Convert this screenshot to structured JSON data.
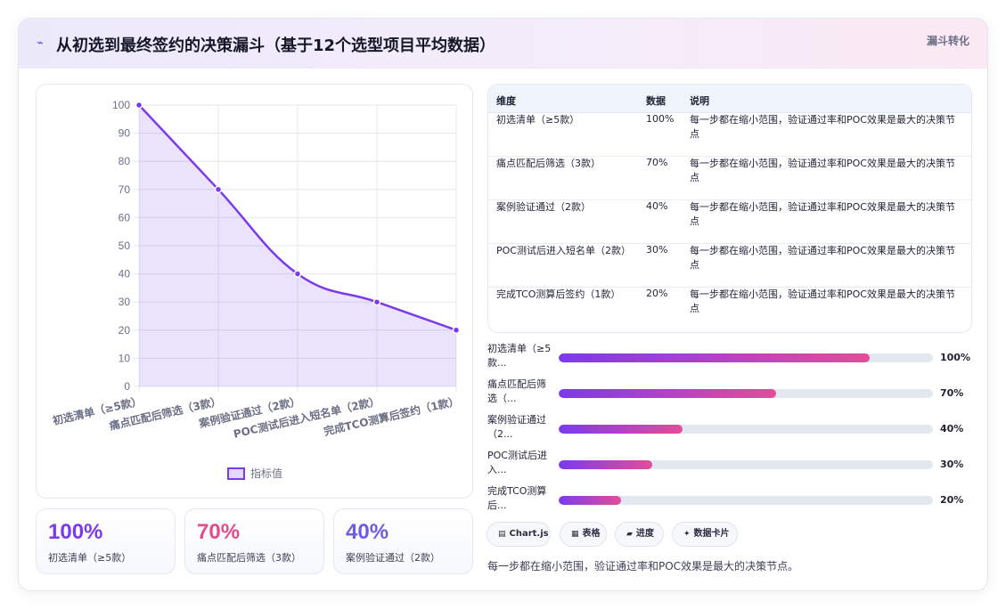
{
  "header": {
    "icon": "lightning-icon",
    "title": "从初选到最终签约的决策漏斗（基于12个选型项目平均数据）",
    "tag": "漏斗转化"
  },
  "chart_data": {
    "type": "area",
    "categories": [
      "初选清单（≥5款）",
      "痛点匹配后筛选（3款）",
      "案例验证通过（2款）",
      "POC测试后进入短名单（2款）",
      "完成TCO测算后签约（1款）"
    ],
    "series": [
      {
        "name": "指标值",
        "values": [
          100,
          70,
          40,
          30,
          20
        ]
      }
    ],
    "ylim": [
      0,
      100
    ],
    "yticks": [
      0,
      10,
      20,
      30,
      40,
      50,
      60,
      70,
      80,
      90,
      100
    ],
    "grid": true,
    "legend": "bottom",
    "color": "#7c3aed"
  },
  "stats": [
    {
      "value": "100%",
      "label": "初选清单（≥5款）",
      "color": "#7c3aed"
    },
    {
      "value": "70%",
      "label": "痛点匹配后筛选（3款）",
      "color": "#e04d8c"
    },
    {
      "value": "40%",
      "label": "案例验证通过（2款）",
      "color": "#6b5ce6"
    }
  ],
  "table": {
    "headers": [
      "维度",
      "数据",
      "说明"
    ],
    "rows": [
      [
        "初选清单（≥5款）",
        "100%",
        "每一步都在缩小范围，验证通过率和POC效果是最大的决策节点"
      ],
      [
        "痛点匹配后筛选（3款）",
        "70%",
        "每一步都在缩小范围，验证通过率和POC效果是最大的决策节点"
      ],
      [
        "案例验证通过（2款）",
        "40%",
        "每一步都在缩小范围，验证通过率和POC效果是最大的决策节点"
      ],
      [
        "POC测试后进入短名单（2款）",
        "30%",
        "每一步都在缩小范围，验证通过率和POC效果是最大的决策节点"
      ],
      [
        "完成TCO测算后签约（1款）",
        "20%",
        "每一步都在缩小范围，验证通过率和POC效果是最大的决策节点"
      ]
    ]
  },
  "progress": [
    {
      "label": "初选清单（≥5款...",
      "value": 100,
      "pct": "100%"
    },
    {
      "label": "痛点匹配后筛选（...",
      "value": 70,
      "pct": "70%"
    },
    {
      "label": "案例验证通过（2...",
      "value": 40,
      "pct": "40%"
    },
    {
      "label": "POC测试后进入...",
      "value": 30,
      "pct": "30%"
    },
    {
      "label": "完成TCO测算后...",
      "value": 20,
      "pct": "20%"
    }
  ],
  "pills": [
    {
      "icon": "chart-icon",
      "label": "Chart.js"
    },
    {
      "icon": "table-icon",
      "label": "表格"
    },
    {
      "icon": "progress-icon",
      "label": "进度"
    },
    {
      "icon": "sparkle-icon",
      "label": "数据卡片"
    }
  ],
  "footnote": "每一步都在缩小范围，验证通过率和POC效果是最大的决策节点。"
}
